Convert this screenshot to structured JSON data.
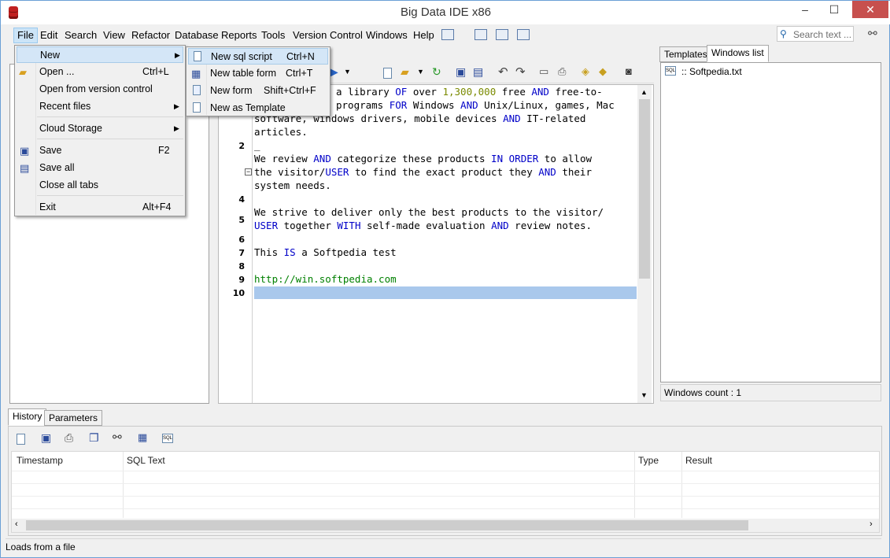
{
  "window": {
    "title": "Big Data IDE x86",
    "minimize": "–",
    "maximize": "☐",
    "close": "✕"
  },
  "menubar": {
    "items": [
      "File",
      "Edit",
      "Search",
      "View",
      "Refactor",
      "Database",
      "Reports",
      "Tools",
      "Version Control",
      "Windows",
      "Help"
    ]
  },
  "search": {
    "placeholder": "Search text ..."
  },
  "file_menu": {
    "items": [
      {
        "label": "New",
        "shortcut": "",
        "submenu": true
      },
      {
        "label": "Open ...",
        "shortcut": "Ctrl+L"
      },
      {
        "label": "Open from version control",
        "shortcut": ""
      },
      {
        "label": "Recent files",
        "shortcut": "",
        "submenu": true
      },
      {
        "label": "Cloud Storage",
        "shortcut": "",
        "submenu": true
      },
      {
        "label": "Save",
        "shortcut": "F2"
      },
      {
        "label": "Save all",
        "shortcut": ""
      },
      {
        "label": "Close all tabs",
        "shortcut": ""
      },
      {
        "label": "Exit",
        "shortcut": "Alt+F4"
      }
    ]
  },
  "new_submenu": {
    "items": [
      {
        "label": "New sql script",
        "shortcut": "Ctrl+N"
      },
      {
        "label": "New table form",
        "shortcut": "Ctrl+T"
      },
      {
        "label": "New form",
        "shortcut": "Shift+Ctrl+F"
      },
      {
        "label": "New as Template",
        "shortcut": ""
      }
    ]
  },
  "editor": {
    "line_numbers": [
      "2",
      "4",
      "5",
      "6",
      "7",
      "8",
      "9",
      "10"
    ],
    "text": {
      "l1a": "a library ",
      "l1b": "OF",
      "l1c": " over ",
      "l1d": "1,300,000",
      "l1e": " free ",
      "l1f": "AND",
      "l1g": " free-to-",
      "l2a": "programs ",
      "l2b": "FOR",
      "l2c": " Windows ",
      "l2d": "AND",
      "l2e": " Unix/Linux, games, Mac",
      "l3a": "software, windows drivers, mobile devices ",
      "l3b": "AND",
      "l3c": " IT-related",
      "l4": "articles.",
      "l5": "_",
      "l6a": "We review ",
      "l6b": "AND",
      "l6c": " categorize these products ",
      "l6d": "IN",
      "l6e": " ",
      "l6f": "ORDER",
      "l6g": " to allow",
      "l7a": "the visitor/",
      "l7b": "USER",
      "l7c": " to find the exact product they ",
      "l7d": "AND",
      "l7e": " their",
      "l8": "system needs.",
      "l9": "We strive to deliver only the best products to the visitor/",
      "l10a": "USER",
      "l10b": " together ",
      "l10c": "WITH",
      "l10d": " self-made evaluation ",
      "l10e": "AND",
      "l10f": " review notes.",
      "l11a": "This ",
      "l11b": "IS",
      "l11c": " a Softpedia test",
      "l12": "http://win.softpedia.com"
    }
  },
  "right_panel": {
    "tabs": [
      "Templates",
      "Windows list"
    ],
    "items": [
      ":: Softpedia.txt"
    ],
    "count_label": "Windows count : 1"
  },
  "bottom_panel": {
    "tabs": [
      "History",
      "Parameters"
    ],
    "columns": [
      "Timestamp",
      "SQL Text",
      "Type",
      "Result"
    ]
  },
  "statusbar": {
    "text": "Loads from a file"
  },
  "colors": {
    "accent": "#cce4f7",
    "keyword": "#0000c8",
    "number": "#7a8a00",
    "url": "#008000",
    "close": "#c7504e"
  }
}
